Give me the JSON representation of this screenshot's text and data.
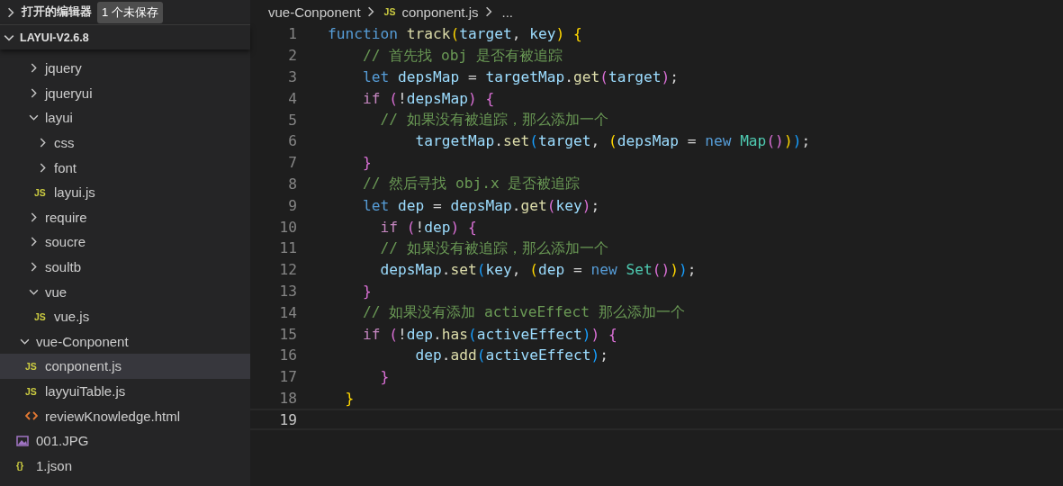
{
  "open_editors": {
    "title": "打开的编辑器",
    "badge": "1 个未保存",
    "expanded": false
  },
  "workspace": {
    "title": "LAYUI-V2.6.8",
    "expanded": true
  },
  "tree": [
    {
      "children": [
        {
          "label": "jquery",
          "kind": "folder",
          "expanded": false,
          "selected": false
        },
        {
          "label": "jqueryui",
          "kind": "folder",
          "expanded": false,
          "selected": false
        },
        {
          "label": "layui",
          "kind": "folder",
          "expanded": true,
          "selected": false,
          "children": [
            {
              "label": "css",
              "kind": "folder",
              "expanded": false,
              "selected": false
            },
            {
              "label": "font",
              "kind": "folder",
              "expanded": false,
              "selected": false
            },
            {
              "label": "layui.js",
              "kind": "js",
              "icon": "JS",
              "selected": false
            }
          ]
        },
        {
          "label": "require",
          "kind": "folder",
          "expanded": false,
          "selected": false
        },
        {
          "label": "soucre",
          "kind": "folder",
          "expanded": false,
          "selected": false
        },
        {
          "label": "soultb",
          "kind": "folder",
          "expanded": false,
          "selected": false
        },
        {
          "label": "vue",
          "kind": "folder",
          "expanded": true,
          "selected": false,
          "children": [
            {
              "label": "vue.js",
              "kind": "js",
              "icon": "JS",
              "selected": false
            }
          ]
        }
      ]
    },
    {
      "label": "vue-Conponent",
      "kind": "folder",
      "expanded": true,
      "selected": false,
      "children": [
        {
          "label": "conponent.js",
          "kind": "js",
          "icon": "JS",
          "selected": true
        },
        {
          "label": "layyuiTable.js",
          "kind": "js",
          "icon": "JS",
          "selected": false
        },
        {
          "label": "reviewKnowledge.html",
          "kind": "html",
          "selected": false
        }
      ]
    },
    {
      "label": "001.JPG",
      "kind": "image",
      "selected": false
    },
    {
      "label": "1.json",
      "kind": "json",
      "icon": "{}",
      "selected": false
    }
  ],
  "breadcrumb": [
    {
      "label": "vue-Conponent",
      "kind": "folder"
    },
    {
      "label": "conponent.js",
      "kind": "js",
      "icon": "JS"
    },
    {
      "label": "...",
      "kind": "more"
    }
  ],
  "code": [
    {
      "number": "1",
      "current": false,
      "tokens": [
        {
          "kind": "kw",
          "text": "function "
        },
        {
          "kind": "fn",
          "text": "track"
        },
        {
          "kind": "b1",
          "text": "("
        },
        {
          "kind": "v",
          "text": "target"
        },
        {
          "kind": "p",
          "text": ", "
        },
        {
          "kind": "v",
          "text": "key"
        },
        {
          "kind": "b1",
          "text": ") "
        },
        {
          "kind": "b1",
          "text": "{"
        }
      ]
    },
    {
      "number": "2",
      "current": false,
      "tokens": [
        {
          "kind": "c",
          "text": "    // 首先找 obj 是否有被追踪"
        }
      ]
    },
    {
      "number": "3",
      "current": false,
      "tokens": [
        {
          "kind": "kw",
          "text": "    let "
        },
        {
          "kind": "v",
          "text": "depsMap"
        },
        {
          "kind": "p",
          "text": " = "
        },
        {
          "kind": "v",
          "text": "targetMap"
        },
        {
          "kind": "p",
          "text": "."
        },
        {
          "kind": "fn",
          "text": "get"
        },
        {
          "kind": "b2",
          "text": "("
        },
        {
          "kind": "v",
          "text": "target"
        },
        {
          "kind": "b2",
          "text": ")"
        },
        {
          "kind": "p",
          "text": ";"
        }
      ]
    },
    {
      "number": "4",
      "current": false,
      "tokens": [
        {
          "kind": "ctl",
          "text": "    if "
        },
        {
          "kind": "b2",
          "text": "("
        },
        {
          "kind": "p",
          "text": "!"
        },
        {
          "kind": "v",
          "text": "depsMap"
        },
        {
          "kind": "b2",
          "text": ") "
        },
        {
          "kind": "b2",
          "text": "{"
        }
      ]
    },
    {
      "number": "5",
      "current": false,
      "tokens": [
        {
          "kind": "c",
          "text": "      // 如果没有被追踪，那么添加一个"
        }
      ]
    },
    {
      "number": "6",
      "current": false,
      "tokens": [
        {
          "kind": "v",
          "text": "          targetMap"
        },
        {
          "kind": "p",
          "text": "."
        },
        {
          "kind": "fn",
          "text": "set"
        },
        {
          "kind": "b3",
          "text": "("
        },
        {
          "kind": "v",
          "text": "target"
        },
        {
          "kind": "p",
          "text": ", "
        },
        {
          "kind": "b1",
          "text": "("
        },
        {
          "kind": "v",
          "text": "depsMap"
        },
        {
          "kind": "p",
          "text": " = "
        },
        {
          "kind": "kw",
          "text": "new "
        },
        {
          "kind": "t",
          "text": "Map"
        },
        {
          "kind": "b2",
          "text": "()"
        },
        {
          "kind": "b1",
          "text": ")"
        },
        {
          "kind": "b3",
          "text": ")"
        },
        {
          "kind": "p",
          "text": ";"
        }
      ]
    },
    {
      "number": "7",
      "current": false,
      "tokens": [
        {
          "kind": "b2",
          "text": "    }"
        }
      ]
    },
    {
      "number": "8",
      "current": false,
      "tokens": [
        {
          "kind": "c",
          "text": "    // 然后寻找 obj.x 是否被追踪"
        }
      ]
    },
    {
      "number": "9",
      "current": false,
      "tokens": [
        {
          "kind": "kw",
          "text": "    let "
        },
        {
          "kind": "v",
          "text": "dep"
        },
        {
          "kind": "p",
          "text": " = "
        },
        {
          "kind": "v",
          "text": "depsMap"
        },
        {
          "kind": "p",
          "text": "."
        },
        {
          "kind": "fn",
          "text": "get"
        },
        {
          "kind": "b2",
          "text": "("
        },
        {
          "kind": "v",
          "text": "key"
        },
        {
          "kind": "b2",
          "text": ")"
        },
        {
          "kind": "p",
          "text": ";"
        }
      ]
    },
    {
      "number": "10",
      "current": false,
      "tokens": [
        {
          "kind": "ctl",
          "text": "      if "
        },
        {
          "kind": "b2",
          "text": "("
        },
        {
          "kind": "p",
          "text": "!"
        },
        {
          "kind": "v",
          "text": "dep"
        },
        {
          "kind": "b2",
          "text": ") "
        },
        {
          "kind": "b2",
          "text": "{"
        }
      ]
    },
    {
      "number": "11",
      "current": false,
      "tokens": [
        {
          "kind": "c",
          "text": "      // 如果没有被追踪，那么添加一个"
        }
      ]
    },
    {
      "number": "12",
      "current": false,
      "tokens": [
        {
          "kind": "v",
          "text": "      depsMap"
        },
        {
          "kind": "p",
          "text": "."
        },
        {
          "kind": "fn",
          "text": "set"
        },
        {
          "kind": "b3",
          "text": "("
        },
        {
          "kind": "v",
          "text": "key"
        },
        {
          "kind": "p",
          "text": ", "
        },
        {
          "kind": "b1",
          "text": "("
        },
        {
          "kind": "v",
          "text": "dep"
        },
        {
          "kind": "p",
          "text": " = "
        },
        {
          "kind": "kw",
          "text": "new "
        },
        {
          "kind": "t",
          "text": "Set"
        },
        {
          "kind": "b2",
          "text": "()"
        },
        {
          "kind": "b1",
          "text": ")"
        },
        {
          "kind": "b3",
          "text": ")"
        },
        {
          "kind": "p",
          "text": ";"
        }
      ]
    },
    {
      "number": "13",
      "current": false,
      "tokens": [
        {
          "kind": "b2",
          "text": "    }"
        }
      ]
    },
    {
      "number": "14",
      "current": false,
      "tokens": [
        {
          "kind": "c",
          "text": "    // 如果没有添加 activeEffect 那么添加一个"
        }
      ]
    },
    {
      "number": "15",
      "current": false,
      "tokens": [
        {
          "kind": "ctl",
          "text": "    if "
        },
        {
          "kind": "b2",
          "text": "("
        },
        {
          "kind": "p",
          "text": "!"
        },
        {
          "kind": "v",
          "text": "dep"
        },
        {
          "kind": "p",
          "text": "."
        },
        {
          "kind": "fn",
          "text": "has"
        },
        {
          "kind": "b3",
          "text": "("
        },
        {
          "kind": "v",
          "text": "activeEffect"
        },
        {
          "kind": "b3",
          "text": ")"
        },
        {
          "kind": "b2",
          "text": ") "
        },
        {
          "kind": "b2",
          "text": "{"
        }
      ]
    },
    {
      "number": "16",
      "current": false,
      "tokens": [
        {
          "kind": "v",
          "text": "          dep"
        },
        {
          "kind": "p",
          "text": "."
        },
        {
          "kind": "fn",
          "text": "add"
        },
        {
          "kind": "b3",
          "text": "("
        },
        {
          "kind": "v",
          "text": "activeEffect"
        },
        {
          "kind": "b3",
          "text": ")"
        },
        {
          "kind": "p",
          "text": ";"
        }
      ]
    },
    {
      "number": "17",
      "current": false,
      "tokens": [
        {
          "kind": "b2",
          "text": "      }"
        }
      ]
    },
    {
      "number": "18",
      "current": false,
      "tokens": [
        {
          "kind": "b1",
          "text": "  }"
        }
      ]
    },
    {
      "number": "19",
      "current": true
    }
  ]
}
